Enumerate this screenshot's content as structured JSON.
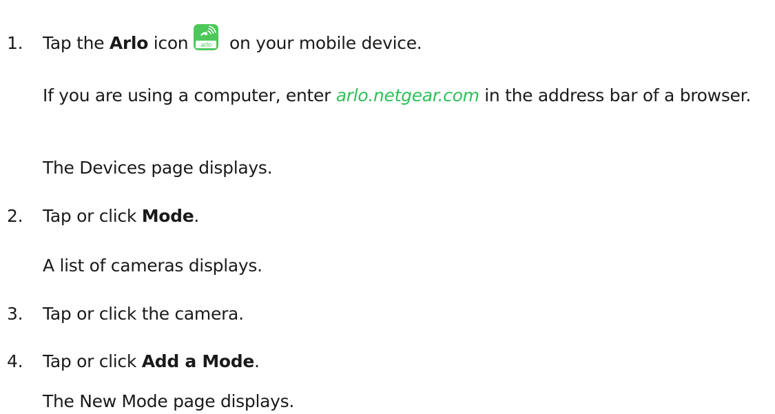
{
  "steps": [
    {
      "number": "1.",
      "text_before": "Tap the ",
      "bold": "Arlo",
      "text_middle": " icon",
      "icon": "arlo-app-icon",
      "icon_text": "arlo",
      "text_after": " on your mobile device.",
      "note_before": "If you are using a computer, enter ",
      "note_link": "arlo.netgear.com",
      "note_after": " in the address bar of a browser.",
      "result": "The Devices page displays."
    },
    {
      "number": "2.",
      "text_before": "Tap or click ",
      "bold": "Mode",
      "text_after": ".",
      "result": "A list of cameras displays."
    },
    {
      "number": "3.",
      "text": "Tap or click the camera."
    },
    {
      "number": "4.",
      "text_before": "Tap or click ",
      "bold": "Add a Mode",
      "text_after": ".",
      "result": "The New Mode page displays."
    }
  ],
  "colors": {
    "link": "#2fbf5a",
    "icon_bg": "#4cc85a",
    "text": "#1a1a1a"
  }
}
